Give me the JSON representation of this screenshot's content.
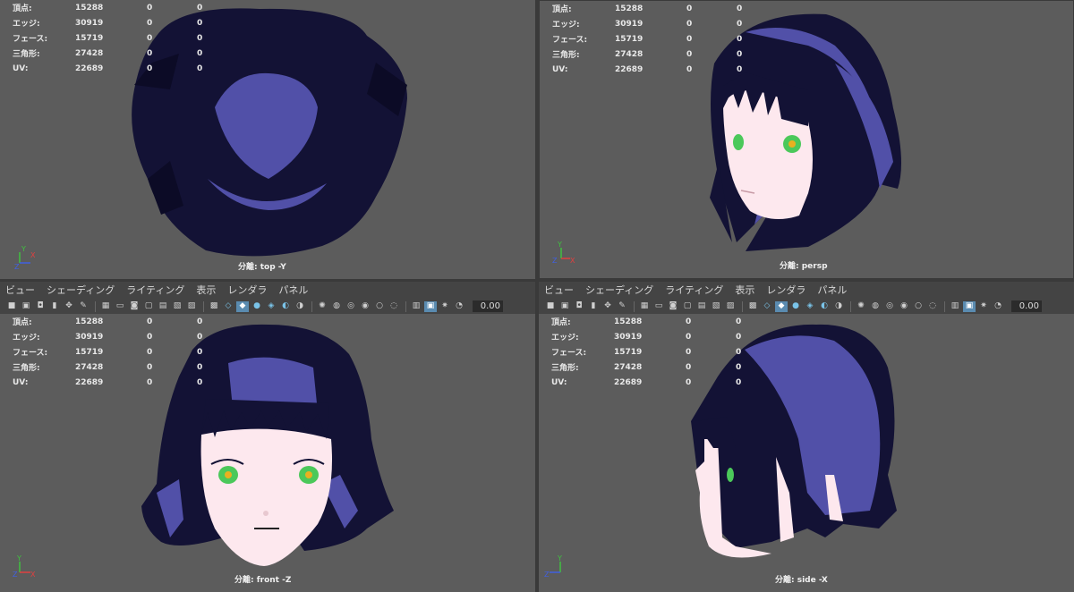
{
  "stats": {
    "labels": [
      "頂点:",
      "エッジ:",
      "フェース:",
      "三角形:",
      "UV:"
    ],
    "values": [
      "15288",
      "30919",
      "15719",
      "27428",
      "22689"
    ],
    "sel": "0",
    "comp": "0"
  },
  "menus": [
    "ビュー",
    "シェーディング",
    "ライティング",
    "表示",
    "レンダラ",
    "パネル"
  ],
  "field_value": "0.00",
  "viewports": {
    "top": "分離: top -Y",
    "persp": "分離: persp",
    "front": "分離: front -Z",
    "side": "分離: side -X"
  },
  "axes": {
    "x": "X",
    "y": "Y",
    "z": "Z"
  },
  "colors": {
    "viewport_bg": "#5c5c5c",
    "hair_dark": "#131235",
    "hair_light": "#5150a8",
    "skin": "#fde8ee",
    "eye": "#4bc85a",
    "axis_x": "#e04040",
    "axis_y": "#40c040",
    "axis_z": "#4060e0"
  },
  "toolbar_icons": [
    "camera-icon",
    "camera-attr-icon",
    "bookmark-icon",
    "image-plane-icon",
    "2d-pan-icon",
    "grease-pencil-icon",
    "grid-icon",
    "film-gate-icon",
    "resolution-gate-icon",
    "gate-mask-icon",
    "field-chart-icon",
    "safe-action-icon",
    "safe-title-icon",
    "isolate-select-icon",
    "wireframe-icon",
    "smooth-shade-icon",
    "use-default-material-icon",
    "wireframe-on-shaded-icon",
    "xray-icon",
    "xray-joints-icon",
    "use-all-lights-icon",
    "shadows-icon",
    "screen-space-ao-icon",
    "motion-blur-icon",
    "multisample-aa-icon",
    "depth-of-field-icon",
    "isolate-select-view-icon",
    "xray-active-icon",
    "exposure-icon",
    "gamma-icon"
  ]
}
